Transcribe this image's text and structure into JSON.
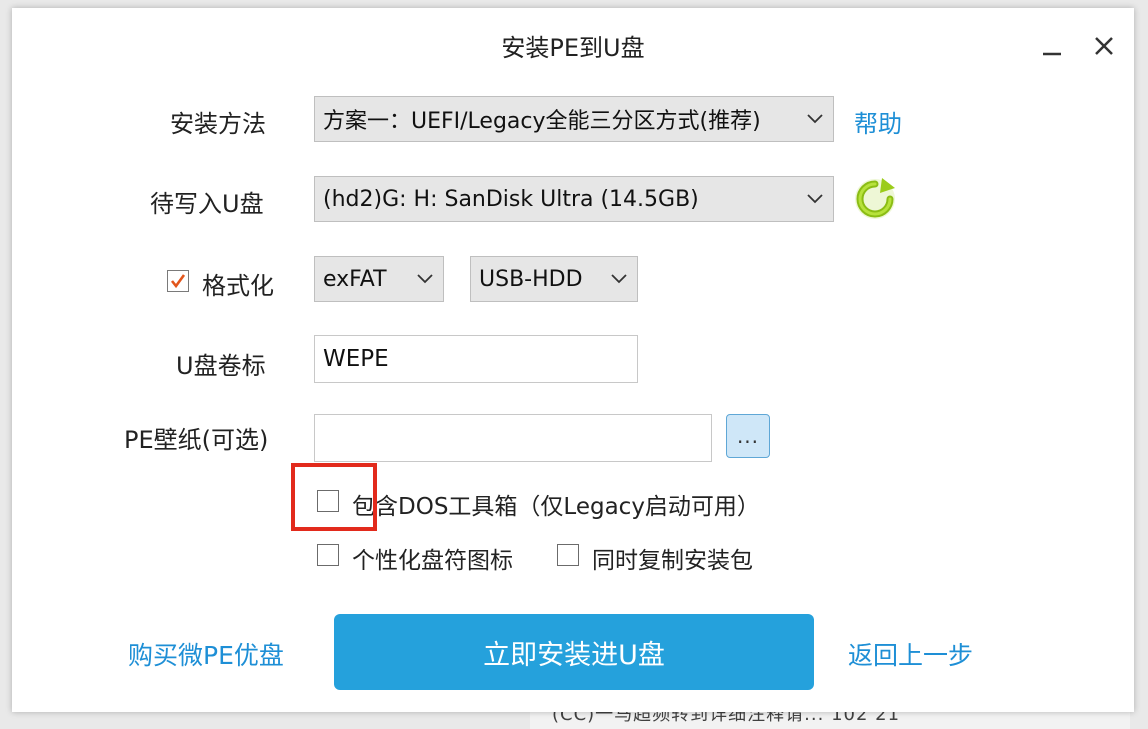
{
  "dialog": {
    "title": "安装PE到U盘"
  },
  "window_controls": {
    "minimize_icon": "minimize-icon",
    "close_icon": "close-icon"
  },
  "form": {
    "install_method": {
      "label": "安装方法",
      "value": "方案一：UEFI/Legacy全能三分区方式(推荐)",
      "help_link": "帮助"
    },
    "target_disk": {
      "label": "待写入U盘",
      "value": "(hd2)G: H: SanDisk Ultra (14.5GB)",
      "refresh_icon": "refresh-icon"
    },
    "format": {
      "label": "格式化",
      "checked": true,
      "filesystem": "exFAT",
      "mode": "USB-HDD"
    },
    "volume_label": {
      "label": "U盘卷标",
      "value": "WEPE"
    },
    "wallpaper": {
      "label": "PE壁纸(可选)",
      "value": "",
      "browse_label": "..."
    },
    "options": {
      "dos_tools": {
        "label": "包含DOS工具箱（仅Legacy启动可用）",
        "checked": false
      },
      "custom_icon": {
        "label": "个性化盘符图标",
        "checked": false
      },
      "copy_package": {
        "label": "同时复制安装包",
        "checked": false
      }
    }
  },
  "footer": {
    "buy_link": "购买微PE优盘",
    "install_button": "立即安装进U盘",
    "back_link": "返回上一步"
  },
  "backdrop": {
    "partial_text": "(CC)一马超频转到详细注释请... 102 21"
  },
  "colors": {
    "accent": "#25a1dc",
    "link": "#1e8fd6",
    "highlight": "#e22a1c",
    "checkmark": "#e2561c",
    "refresh_green": "#9bcc1a"
  }
}
